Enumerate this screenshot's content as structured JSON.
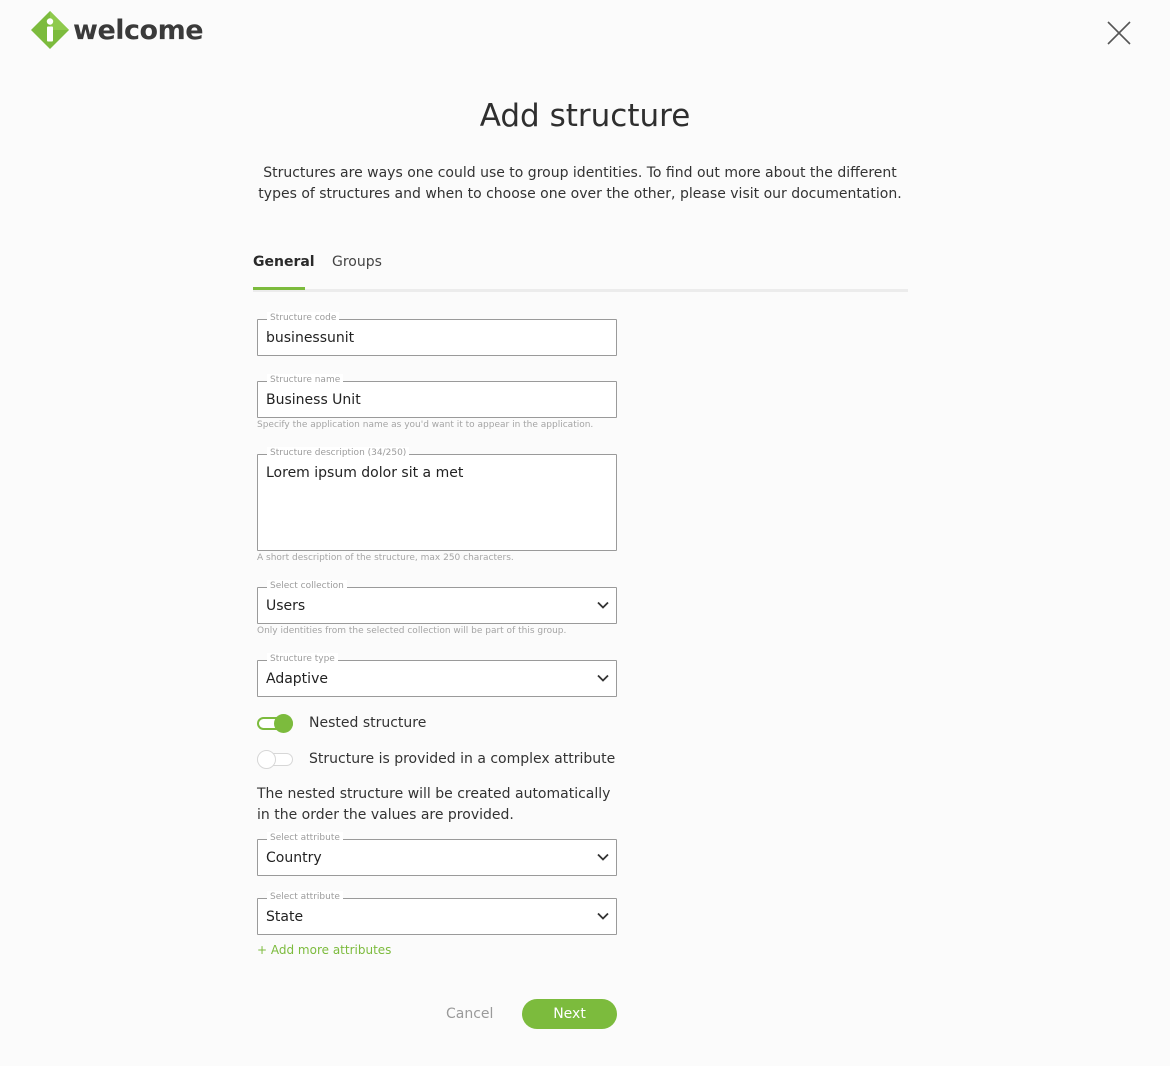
{
  "brand": {
    "name": "welcome",
    "accent_color": "#7cbb3d",
    "logo_glyph": "i"
  },
  "header": {
    "close_icon": "close-icon"
  },
  "page": {
    "title": "Add structure",
    "intro": "Structures are ways one could use to group identities. To find out more about the different types of structures and when to choose one over the other, please visit our documentation."
  },
  "tabs": [
    {
      "label": "General",
      "active": true
    },
    {
      "label": "Groups",
      "active": false
    }
  ],
  "form": {
    "structure_code": {
      "label": "Structure code",
      "value": "businessunit"
    },
    "structure_name": {
      "label": "Structure name",
      "value": "Business Unit",
      "hint": "Specify the application name as you'd want it to appear in the application."
    },
    "structure_description": {
      "label": "Structure description (34/250)",
      "value": "Lorem ipsum dolor sit a met",
      "hint": "A short description of the structure, max 250 characters."
    },
    "collection": {
      "label": "Select collection",
      "value": "Users",
      "hint": "Only identities from the selected collection will be part of this group."
    },
    "structure_type": {
      "label": "Structure type",
      "value": "Adaptive"
    },
    "nested_toggle": {
      "label": "Nested structure",
      "on": true
    },
    "complex_toggle": {
      "label": "Structure is provided in a complex attribute",
      "on": false
    },
    "note": "The nested structure will be created automatically in the order the values are provided.",
    "attributes": [
      {
        "label": "Select attribute",
        "value": "Country"
      },
      {
        "label": "Select attribute",
        "value": "State"
      }
    ],
    "add_more": "+ Add more attributes"
  },
  "actions": {
    "cancel": "Cancel",
    "next": "Next"
  }
}
